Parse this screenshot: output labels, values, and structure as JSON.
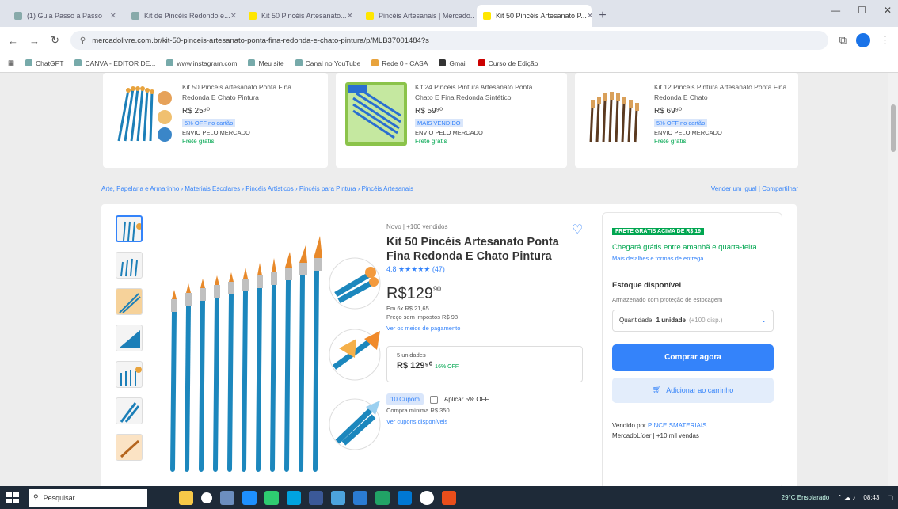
{
  "browser": {
    "tabs": [
      {
        "label": "(1) Guia Passo a Passo"
      },
      {
        "label": "Kit de Pincéis Redondo e..."
      },
      {
        "label": "Kit 50 Pincéis Artesanato..."
      },
      {
        "label": "Pincéis Artesanais | Mercado..."
      },
      {
        "label": "Kit 50 Pincéis Artesanato P...",
        "active": true
      }
    ],
    "url": "mercadolivre.com.br/kit-50-pinceis-artesanato-ponta-fina-redonda-e-chato-pintura/p/MLB37001484?s",
    "bookmarks": [
      "ChatGPT",
      "CANVA - EDITOR DE...",
      "www.instagram.com",
      "Meu site",
      "Canal no YouTube",
      "Rede 0 - CASA",
      "Gmail",
      "Curso de Edição"
    ]
  },
  "recommendations": [
    {
      "title": "Kit 50 Pincéis Artesanato Ponta Fina Redonda E Chato Pintura",
      "price": "R$ 25⁹⁰",
      "badge": "5% OFF no cartão",
      "sub": "ENVIO PELO MERCADO",
      "shipping": "Frete grátis"
    },
    {
      "title": "Kit 24 Pincéis Pintura Artesanato Ponta Chato E Fina Redonda Sintético",
      "price": "R$ 59⁹⁰",
      "badge": "MAIS VENDIDO",
      "sub": "ENVIO PELO MERCADO",
      "shipping": "Frete grátis"
    },
    {
      "title": "Kit 12 Pincéis Pintura Artesanato Ponta Fina Redonda E Chato",
      "price": "R$ 69⁹⁰",
      "badge": "5% OFF no cartão",
      "sub": "ENVIO PELO MERCADO",
      "shipping": "Frete grátis"
    }
  ],
  "breadcrumb": {
    "path": "Arte, Papelaria e Armarinho  ›  Materiais Escolares  ›  Pincéis Artísticos  ›  Pincéis para Pintura  ›  Pincéis Artesanais",
    "right": "Vender um igual  |  Compartilhar"
  },
  "product": {
    "condition": "Novo | +100 vendidos",
    "title": "Kit 50 Pincéis Artesanato Ponta Fina Redonda E Chato Pintura",
    "rating_text": "4.8 ★★★★★ (47)",
    "price_main": "R$129",
    "price_cents": "90",
    "price_prev": "Em 6x R$ 21,65",
    "price_note": "Preço sem impostos R$ 98",
    "payment_link": "Ver os meios de pagamento",
    "option_label": "5 unidades",
    "option_value": "R$ 129⁹⁰",
    "option_off": "16% OFF",
    "coupon_chip": "10 Cupom",
    "coupon_check_label": "Aplicar 5% OFF",
    "coupon_note": "Compra mínima R$ 350",
    "coupon_link": "Ver cupons disponíveis"
  },
  "buybox": {
    "promo": "FRETE GRÁTIS ACIMA DE R$ 19",
    "shipping": "Chegará grátis entre amanhã e quarta-feira",
    "shipping_more": "Mais detalhes e formas de entrega",
    "stock": "Estoque disponível",
    "stock_sub": "Armazenado com proteção de estocagem",
    "qty_label": "Quantidade:",
    "qty_value": "1 unidade",
    "qty_avail": "(+100 disp.)",
    "buy_label": "Comprar agora",
    "cart_label": "Adicionar ao carrinho",
    "seller_label": "Vendido por",
    "seller_name": "PINCEISMATERIAIS",
    "seller_info": "MercadoLíder | +10 mil vendas"
  },
  "taskbar": {
    "search_placeholder": "Pesquisar",
    "weather": "29°C Ensolarado",
    "time": "08:43"
  }
}
